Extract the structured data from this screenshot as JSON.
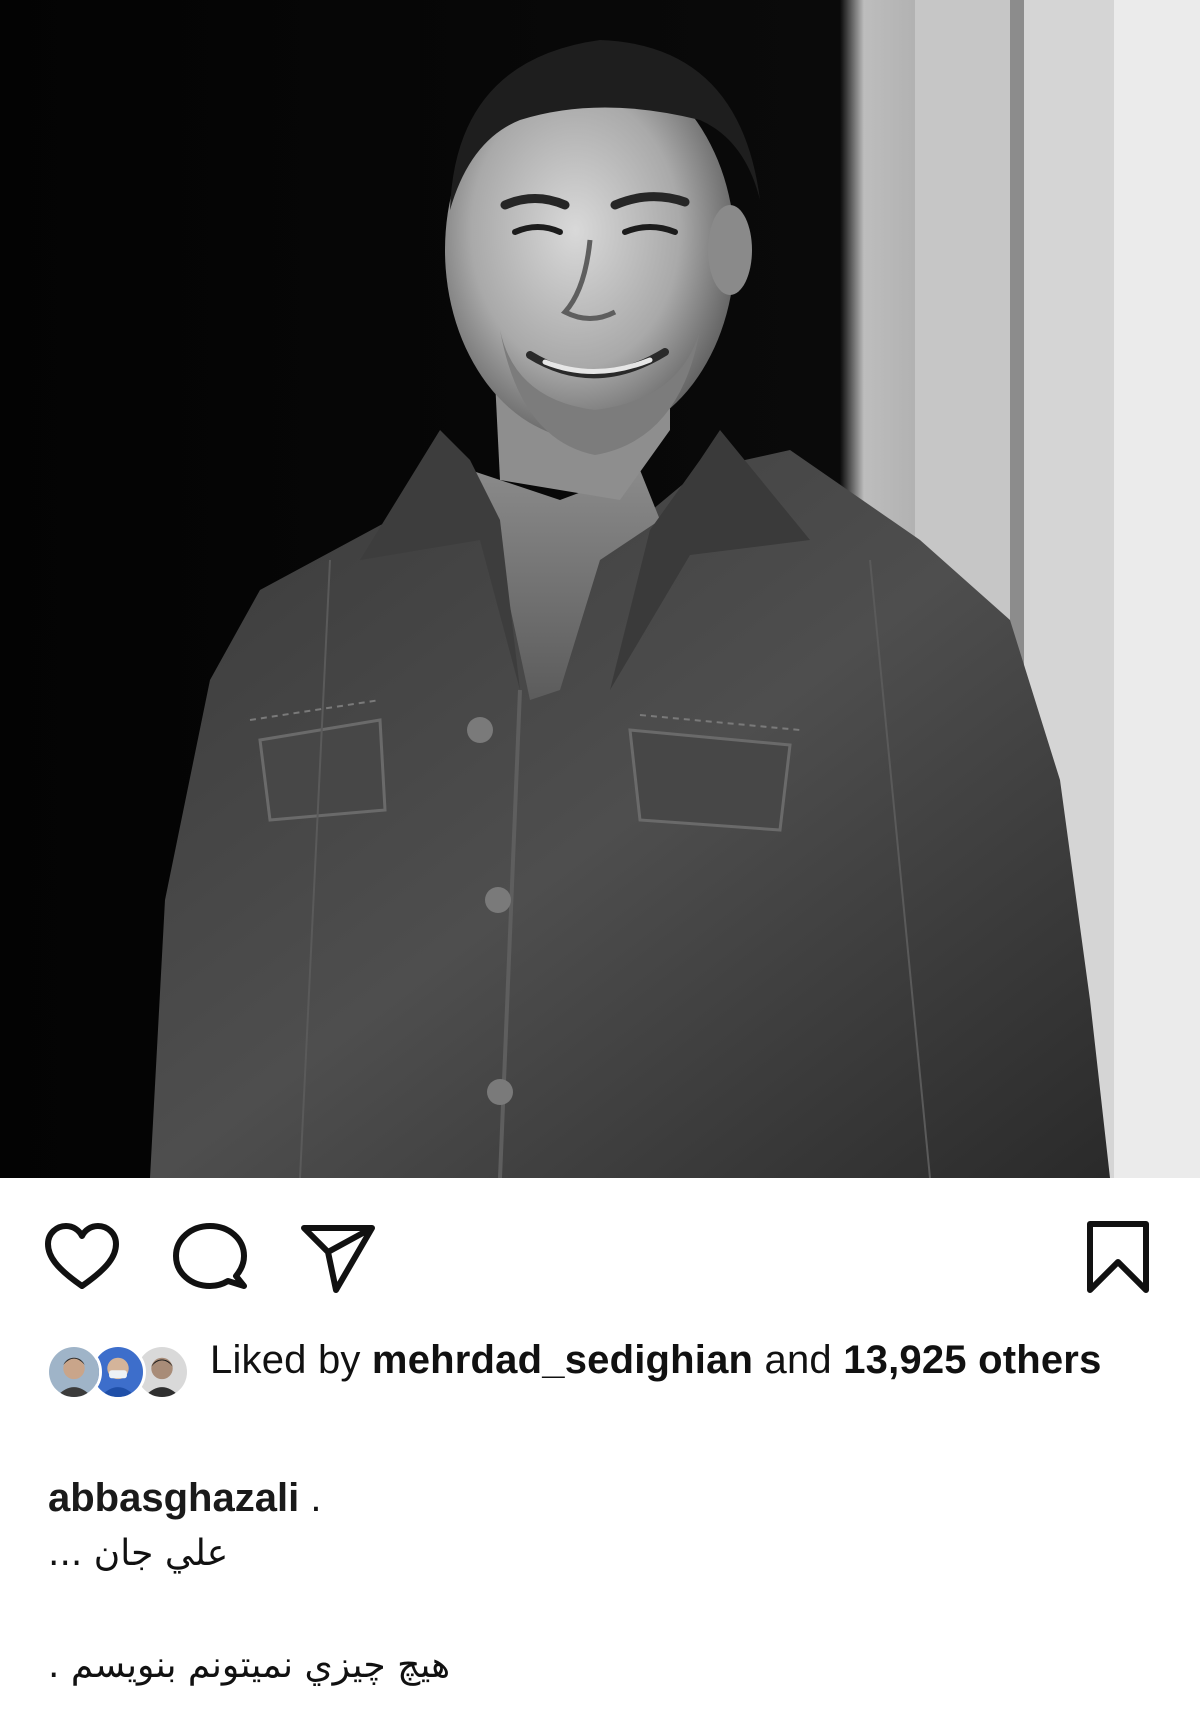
{
  "post": {
    "image": {
      "kind": "photo"
    },
    "actions": {
      "like_icon": "heart-outline-icon",
      "comment_icon": "comment-bubble-icon",
      "share_icon": "send-paper-plane-icon",
      "save_icon": "bookmark-outline-icon"
    },
    "likes": {
      "prefix": "Liked by",
      "user": "mehrdad_sedighian",
      "connector": "and",
      "count": "13,925",
      "suffix": "others",
      "avatar_count": 3
    },
    "caption": {
      "username": "abbasghazali",
      "after_username": " .",
      "lines": [
        "علي جان ...",
        "",
        "هيچ چيزي نميتونم بنويسم ."
      ]
    }
  },
  "colors": {
    "text": "#111111",
    "background": "#ffffff",
    "icon": "#111111"
  }
}
